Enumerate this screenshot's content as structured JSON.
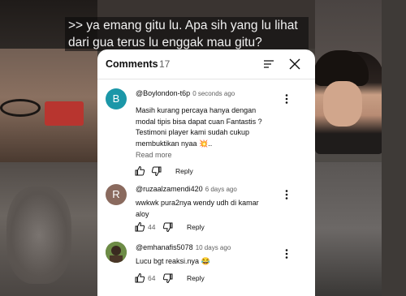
{
  "subtitle": {
    "line1": ">> ya emang gitu lu. Apa sih yang lu lihat",
    "line2": "dari gua terus lu enggak mau gitu?"
  },
  "comments_panel": {
    "title": "Comments",
    "count": "17",
    "icons": {
      "sort": "sort-icon",
      "close": "close-icon"
    },
    "reply_label": "Reply",
    "read_more_label": "Read more",
    "comments": [
      {
        "avatar_letter": "B",
        "avatar_color": "#1b97a8",
        "author": "@Boylondon-t6p",
        "time": "0 seconds ago",
        "lines": [
          "Masih kurang percaya hanya dengan",
          "modal tipis bisa dapat cuan Fantastis ?",
          "Testimoni player kami sudah cukup",
          "membuktikan nyaa 💥.."
        ],
        "likes": ""
      },
      {
        "avatar_letter": "R",
        "avatar_color": "#8a6a5e",
        "author": "@ruzaalzamendi420",
        "time": "6 days ago",
        "lines": [
          "wwkwk pura2nya wendy udh di kamar",
          "aloy"
        ],
        "likes": "44"
      },
      {
        "avatar_letter": "",
        "avatar_color": "#5b7a3a",
        "author": "@emhanafis5078",
        "time": "10 days ago",
        "lines": [
          "Lucu bgt reaksi.nya 😂"
        ],
        "likes": "64"
      }
    ]
  }
}
